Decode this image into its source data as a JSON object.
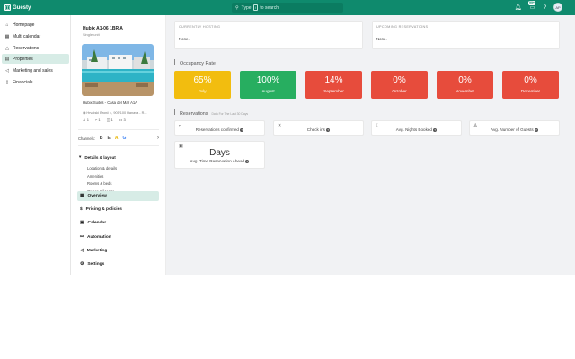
{
  "app": {
    "brand": "Guesty"
  },
  "search": {
    "prefix": "Type",
    "key": "/",
    "suffix": "to search"
  },
  "header": {
    "messages_badge": "99+",
    "avatar_initials": "AP"
  },
  "sidebar": {
    "items": [
      {
        "label": "Homepage",
        "icon": "home-icon"
      },
      {
        "label": "Multi calendar",
        "icon": "calendar-icon"
      },
      {
        "label": "Reservations",
        "icon": "triangle-icon"
      },
      {
        "label": "Properties",
        "icon": "properties-icon",
        "active": true
      },
      {
        "label": "Marketing and sales",
        "icon": "megaphone-icon"
      },
      {
        "label": "Financials",
        "icon": "document-icon"
      }
    ]
  },
  "property": {
    "title": "Hubix A1-06 1BR A",
    "subtitle": "Single unit",
    "name": "Hubix Suites - Casa del Mar A1A",
    "address": "Hrvatski Bronč 4, 905/100 Hanava - R...",
    "stats": [
      "1",
      "1",
      "1",
      "3"
    ]
  },
  "channels": {
    "label": "Channels:",
    "items": [
      "B",
      "E",
      "A",
      "G"
    ],
    "arrow": "›"
  },
  "details_menu": {
    "head": "Details & layout",
    "items": [
      "Location & details",
      "Amenities",
      "Rooms & beds",
      "Owner & license",
      "Custom fields"
    ]
  },
  "main_menu": [
    {
      "label": "Overview",
      "icon": "grid-icon",
      "active": true
    },
    {
      "label": "Pricing & policies",
      "icon": "dollar-icon"
    },
    {
      "label": "Calendar",
      "icon": "calendar-icon"
    },
    {
      "label": "Automation",
      "icon": "automation-icon"
    },
    {
      "label": "Marketing",
      "icon": "megaphone-icon"
    },
    {
      "label": "Settings",
      "icon": "gear-icon"
    }
  ],
  "currently_hosting": {
    "head": "CURRENTLY HOSTING",
    "value": "None."
  },
  "upcoming": {
    "head": "UPCOMING RESERVATIONS",
    "value": "None."
  },
  "occupancy": {
    "title": "Occupancy Rate",
    "tiles": [
      {
        "value": "65%",
        "label": "July",
        "color": "#f2bd0f",
        "fraction": 0.65
      },
      {
        "value": "100%",
        "label": "August",
        "color": "#27ae60",
        "fraction": 1.0
      },
      {
        "value": "14%",
        "label": "September",
        "color": "#e74c3c",
        "fraction": 0.14
      },
      {
        "value": "0%",
        "label": "October",
        "color": "#e74c3c",
        "fraction": 0.0
      },
      {
        "value": "0%",
        "label": "November",
        "color": "#e74c3c",
        "fraction": 0.0
      },
      {
        "value": "0%",
        "label": "December",
        "color": "#e74c3c",
        "fraction": 0.0
      }
    ]
  },
  "reservations": {
    "title": "Reservations",
    "subtitle": "Data For The Last 30 Days",
    "cards": [
      {
        "label": "Reservations confirmed",
        "icon": "bed-icon"
      },
      {
        "label": "Check ins",
        "icon": "key-icon"
      },
      {
        "label": "Avg. Nights Booked",
        "icon": "moon-icon"
      },
      {
        "label": "Avg. Number of Guests",
        "icon": "guests-icon"
      }
    ],
    "days": {
      "value": "Days",
      "label": "Avg. Time Reservation Ahead"
    }
  }
}
